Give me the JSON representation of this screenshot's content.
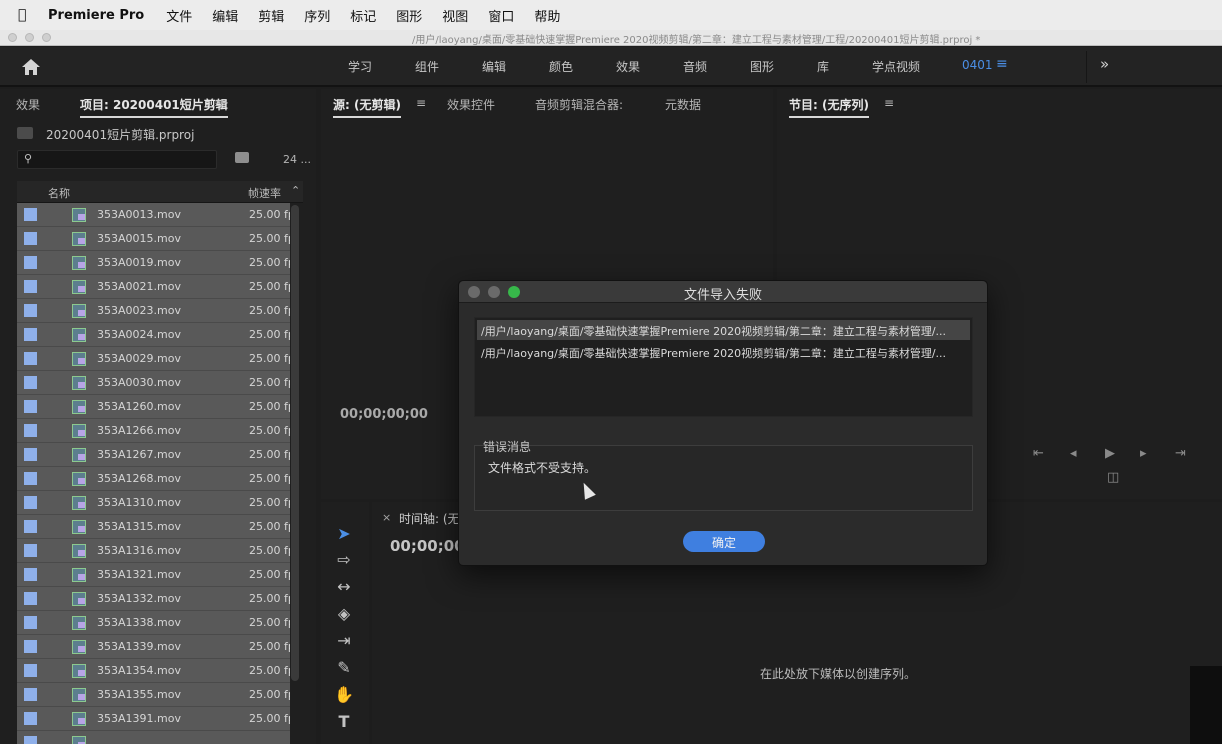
{
  "menubar": {
    "app_name": "Premiere Pro",
    "items": [
      "文件",
      "编辑",
      "剪辑",
      "序列",
      "标记",
      "图形",
      "视图",
      "窗口",
      "帮助"
    ]
  },
  "window": {
    "path": "/用户/laoyang/桌面/零基础快速掌握Premiere 2020视频剪辑/第二章：建立工程与素材管理/工程/20200401短片剪辑.prproj *"
  },
  "workspaces": {
    "tabs": [
      "学习",
      "组件",
      "编辑",
      "颜色",
      "效果",
      "音频",
      "图形",
      "库",
      "学点视频",
      "0401"
    ],
    "active": "0401",
    "menu_icon": "≡",
    "more_icon": "»"
  },
  "project_panel": {
    "tab_effects": "效果",
    "tab_project": "项目: 20200401短片剪辑",
    "menu_icon": "≡",
    "project_file": "20200401短片剪辑.prproj",
    "search_placeholder": "",
    "item_count": "24 ...",
    "col_name": "名称",
    "col_fps": "帧速率",
    "label_color": "#8fb0ea",
    "items": [
      {
        "name": "353A0013.mov",
        "fps": "25.00 fps"
      },
      {
        "name": "353A0015.mov",
        "fps": "25.00 fps"
      },
      {
        "name": "353A0019.mov",
        "fps": "25.00 fps"
      },
      {
        "name": "353A0021.mov",
        "fps": "25.00 fps"
      },
      {
        "name": "353A0023.mov",
        "fps": "25.00 fps"
      },
      {
        "name": "353A0024.mov",
        "fps": "25.00 fps"
      },
      {
        "name": "353A0029.mov",
        "fps": "25.00 fps"
      },
      {
        "name": "353A0030.mov",
        "fps": "25.00 fps"
      },
      {
        "name": "353A1260.mov",
        "fps": "25.00 fps"
      },
      {
        "name": "353A1266.mov",
        "fps": "25.00 fps"
      },
      {
        "name": "353A1267.mov",
        "fps": "25.00 fps"
      },
      {
        "name": "353A1268.mov",
        "fps": "25.00 fps"
      },
      {
        "name": "353A1310.mov",
        "fps": "25.00 fps"
      },
      {
        "name": "353A1315.mov",
        "fps": "25.00 fps"
      },
      {
        "name": "353A1316.mov",
        "fps": "25.00 fps"
      },
      {
        "name": "353A1321.mov",
        "fps": "25.00 fps"
      },
      {
        "name": "353A1332.mov",
        "fps": "25.00 fps"
      },
      {
        "name": "353A1338.mov",
        "fps": "25.00 fps"
      },
      {
        "name": "353A1339.mov",
        "fps": "25.00 fps"
      },
      {
        "name": "353A1354.mov",
        "fps": "25.00 fps"
      },
      {
        "name": "353A1355.mov",
        "fps": "25.00 fps"
      },
      {
        "name": "353A1391.mov",
        "fps": "25.00 fps"
      },
      {
        "name": "",
        "fps": ""
      }
    ]
  },
  "source_panel": {
    "tab_source": "源: (无剪辑)",
    "menu_icon": "≡",
    "tab_effect_controls": "效果控件",
    "tab_audio_mixer": "音频剪辑混合器:",
    "tab_metadata": "元数据",
    "timecode": "00;00;00;00"
  },
  "program_panel": {
    "tab_program": "节目: (无序列)",
    "menu_icon": "≡",
    "transport": [
      "⇤",
      "◂",
      "▶",
      "▸",
      "⇥",
      "◫"
    ]
  },
  "tools": [
    "selection-tool",
    "track-select-tool",
    "ripple-edit-tool",
    "razor-tool",
    "slip-tool",
    "pen-tool",
    "hand-tool",
    "type-tool"
  ],
  "timeline": {
    "close": "×",
    "tab": "时间轴: (无",
    "timecode": "00;00;00;",
    "drop_hint": "在此处放下媒体以创建序列。"
  },
  "dialog": {
    "title": "文件导入失败",
    "files": [
      "/用户/laoyang/桌面/零基础快速掌握Premiere 2020视频剪辑/第二章：建立工程与素材管理/...",
      "/用户/laoyang/桌面/零基础快速掌握Premiere 2020视频剪辑/第二章：建立工程与素材管理/..."
    ],
    "error_label": "错误消息",
    "error_text": "文件格式不受支持。",
    "ok_label": "确定",
    "accent": "#3f7fe0"
  }
}
